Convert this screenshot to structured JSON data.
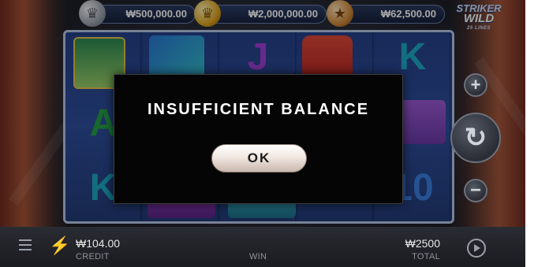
{
  "jackpots": {
    "mini": "₩500,000.00",
    "grand": "₩2,000,000.00",
    "major": "₩62,500.00"
  },
  "logo": {
    "line1": "STRIKER",
    "line2": "WILD",
    "line3": "25 LINES"
  },
  "reels": {
    "symbols": [
      "J",
      "K",
      "A",
      "K",
      "10"
    ]
  },
  "modal": {
    "title": "INSUFFICIENT BALANCE",
    "ok_label": "OK"
  },
  "bottom": {
    "credit_value": "₩104.00",
    "credit_label": "CREDIT",
    "win_label": "WIN",
    "total_value": "₩2500",
    "total_label": "TOTAL"
  },
  "controls": {
    "plus": "+",
    "minus": "−",
    "spin": "↻"
  },
  "icons": {
    "menu": "menu-icon",
    "turbo": "lightning-icon",
    "autoplay": "play-icon"
  },
  "colors": {
    "modal_bg": "#050505",
    "ok_button": "#f1e8e2",
    "reel_bg": "#284a9a"
  }
}
